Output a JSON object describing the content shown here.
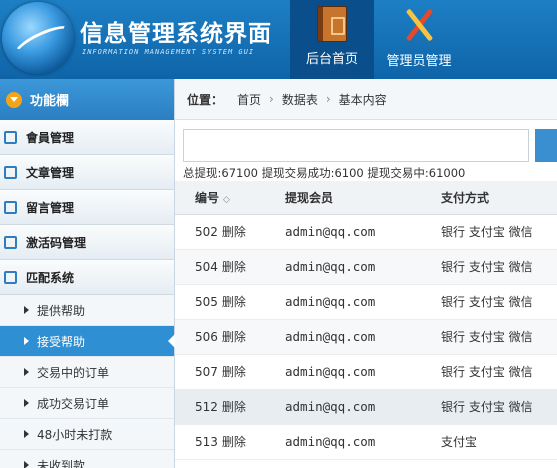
{
  "header": {
    "title": "信息管理系统界面",
    "subtitle": "INFORMATION MANAGEMENT SYSTEM GUI",
    "nav": [
      {
        "label": "后台首页",
        "icon": "book-icon",
        "active": true
      },
      {
        "label": "管理员管理",
        "icon": "tools-icon",
        "active": false
      }
    ]
  },
  "sidebar": {
    "title": "功能欄",
    "groups": [
      {
        "label": "會員管理"
      },
      {
        "label": "文章管理"
      },
      {
        "label": "留言管理"
      },
      {
        "label": "激活码管理"
      },
      {
        "label": "匹配系统"
      }
    ],
    "subitems": [
      {
        "label": "提供帮助"
      },
      {
        "label": "接受帮助",
        "active": true
      },
      {
        "label": "交易中的订单"
      },
      {
        "label": "成功交易订单"
      },
      {
        "label": "48小时未打款"
      },
      {
        "label": "未收到款"
      }
    ]
  },
  "breadcrumb": {
    "label": "位置：",
    "items": [
      "首页",
      "数据表",
      "基本内容"
    ],
    "separator": "›"
  },
  "search": {
    "value": "",
    "placeholder": ""
  },
  "stats": "总提现:67100 提现交易成功:6100 提现交易中:61000",
  "table": {
    "headers": [
      "编号",
      "提现会员",
      "支付方式"
    ],
    "sort_icon": "◇",
    "rows": [
      {
        "id": "502",
        "action": "删除",
        "member": "admin@qq.com",
        "pay": "银行 支付宝 微信"
      },
      {
        "id": "504",
        "action": "删除",
        "member": "admin@qq.com",
        "pay": "银行 支付宝 微信"
      },
      {
        "id": "505",
        "action": "删除",
        "member": "admin@qq.com",
        "pay": "银行 支付宝 微信"
      },
      {
        "id": "506",
        "action": "删除",
        "member": "admin@qq.com",
        "pay": "银行 支付宝 微信"
      },
      {
        "id": "507",
        "action": "删除",
        "member": "admin@qq.com",
        "pay": "银行 支付宝 微信"
      },
      {
        "id": "512",
        "action": "删除",
        "member": "admin@qq.com",
        "pay": "银行 支付宝 微信"
      },
      {
        "id": "513",
        "action": "删除",
        "member": "admin@qq.com",
        "pay": "支付宝"
      }
    ]
  },
  "colors": {
    "header_bg": "#1670b8",
    "active_nav": "#0a4f8c",
    "sidebar_active": "#2f8fd3",
    "accent": "#3a8fd0"
  }
}
